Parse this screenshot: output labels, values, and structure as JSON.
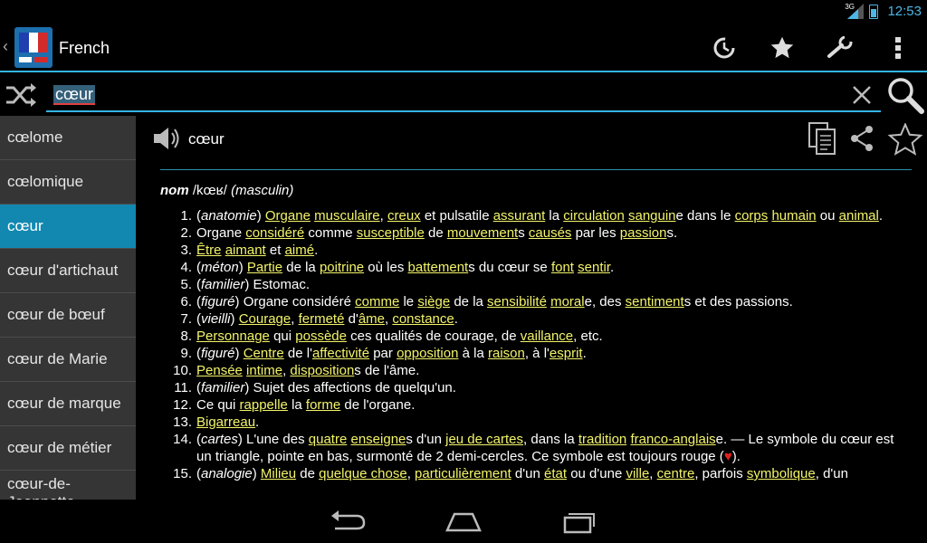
{
  "status": {
    "network": "3G",
    "time": "12:53"
  },
  "app": {
    "title": "French"
  },
  "search": {
    "query": "cœur"
  },
  "word_list": [
    {
      "label": "cœlome",
      "selected": false
    },
    {
      "label": "cœlomique",
      "selected": false
    },
    {
      "label": "cœur",
      "selected": true
    },
    {
      "label": "cœur d'artichaut",
      "selected": false
    },
    {
      "label": "cœur de bœuf",
      "selected": false
    },
    {
      "label": "cœur de Marie",
      "selected": false
    },
    {
      "label": "cœur de marque",
      "selected": false
    },
    {
      "label": "cœur de métier",
      "selected": false
    },
    {
      "label": "cœur-de-Jeannette",
      "selected": false
    }
  ],
  "entry": {
    "headword": "cœur",
    "pos_label": "nom",
    "pronunciation": "/kœʁ/",
    "gender": "(masculin)",
    "definitions": [
      {
        "num": "1.",
        "parts": [
          [
            "(",
            0
          ],
          [
            "anatomie",
            2
          ],
          [
            ") ",
            0
          ],
          [
            "Organe",
            1
          ],
          [
            " ",
            0
          ],
          [
            "musculaire",
            1
          ],
          [
            ", ",
            0
          ],
          [
            "creux",
            1
          ],
          [
            " et pulsatile ",
            0
          ],
          [
            "assurant",
            1
          ],
          [
            " la ",
            0
          ],
          [
            "circulation",
            1
          ],
          [
            " ",
            0
          ],
          [
            "sanguin",
            1
          ],
          [
            "e dans le ",
            0
          ],
          [
            "corps",
            1
          ],
          [
            " ",
            0
          ],
          [
            "humain",
            1
          ],
          [
            " ou ",
            0
          ],
          [
            "animal",
            1
          ],
          [
            ".",
            0
          ]
        ]
      },
      {
        "num": "2.",
        "parts": [
          [
            "Organe ",
            0
          ],
          [
            "considéré",
            1
          ],
          [
            " comme ",
            0
          ],
          [
            "susceptible",
            1
          ],
          [
            " de ",
            0
          ],
          [
            "mouvement",
            1
          ],
          [
            "s ",
            0
          ],
          [
            "causés",
            1
          ],
          [
            " par les ",
            0
          ],
          [
            "passion",
            1
          ],
          [
            "s.",
            0
          ]
        ]
      },
      {
        "num": "3.",
        "parts": [
          [
            "Être",
            1
          ],
          [
            " ",
            0
          ],
          [
            "aimant",
            1
          ],
          [
            " et ",
            0
          ],
          [
            "aimé",
            1
          ],
          [
            ".",
            0
          ]
        ]
      },
      {
        "num": "4.",
        "parts": [
          [
            "(",
            0
          ],
          [
            "méton",
            2
          ],
          [
            ") ",
            0
          ],
          [
            "Partie",
            1
          ],
          [
            " de la ",
            0
          ],
          [
            "poitrine",
            1
          ],
          [
            " où les ",
            0
          ],
          [
            "battement",
            1
          ],
          [
            "s du cœur se ",
            0
          ],
          [
            "font",
            1
          ],
          [
            " ",
            0
          ],
          [
            "sentir",
            1
          ],
          [
            ".",
            0
          ]
        ]
      },
      {
        "num": "5.",
        "parts": [
          [
            "(",
            0
          ],
          [
            "familier",
            2
          ],
          [
            ") Estomac.",
            0
          ]
        ]
      },
      {
        "num": "6.",
        "parts": [
          [
            "(",
            0
          ],
          [
            "figuré",
            2
          ],
          [
            ") Organe considéré ",
            0
          ],
          [
            "comme",
            1
          ],
          [
            " le ",
            0
          ],
          [
            "siège",
            1
          ],
          [
            " de la ",
            0
          ],
          [
            "sensibilité",
            1
          ],
          [
            " ",
            0
          ],
          [
            "moral",
            1
          ],
          [
            "e, des ",
            0
          ],
          [
            "sentiment",
            1
          ],
          [
            "s et des passions.",
            0
          ]
        ]
      },
      {
        "num": "7.",
        "parts": [
          [
            "(",
            0
          ],
          [
            "vieilli",
            2
          ],
          [
            ") ",
            0
          ],
          [
            "Courage",
            1
          ],
          [
            ", ",
            0
          ],
          [
            "fermeté",
            1
          ],
          [
            " d'",
            0
          ],
          [
            "âme",
            1
          ],
          [
            ", ",
            0
          ],
          [
            "constance",
            1
          ],
          [
            ".",
            0
          ]
        ]
      },
      {
        "num": "8.",
        "parts": [
          [
            "Personnage",
            1
          ],
          [
            " qui ",
            0
          ],
          [
            "possède",
            1
          ],
          [
            " ces qualités de courage, de ",
            0
          ],
          [
            "vaillance",
            1
          ],
          [
            ", etc.",
            0
          ]
        ]
      },
      {
        "num": "9.",
        "parts": [
          [
            "(",
            0
          ],
          [
            "figuré",
            2
          ],
          [
            ") ",
            0
          ],
          [
            "Centre",
            1
          ],
          [
            " de l'",
            0
          ],
          [
            "affectivité",
            1
          ],
          [
            " par ",
            0
          ],
          [
            "opposition",
            1
          ],
          [
            " à la ",
            0
          ],
          [
            "raison",
            1
          ],
          [
            ", à l'",
            0
          ],
          [
            "esprit",
            1
          ],
          [
            ".",
            0
          ]
        ]
      },
      {
        "num": "10.",
        "parts": [
          [
            "Pensée",
            1
          ],
          [
            " ",
            0
          ],
          [
            "intime",
            1
          ],
          [
            ", ",
            0
          ],
          [
            "disposition",
            1
          ],
          [
            "s de l'âme.",
            0
          ]
        ]
      },
      {
        "num": "11.",
        "parts": [
          [
            "(",
            0
          ],
          [
            "familier",
            2
          ],
          [
            ") Sujet des affections de quelqu'un.",
            0
          ]
        ]
      },
      {
        "num": "12.",
        "parts": [
          [
            "Ce qui ",
            0
          ],
          [
            "rappelle",
            1
          ],
          [
            " la ",
            0
          ],
          [
            "forme",
            1
          ],
          [
            " de l'organe.",
            0
          ]
        ]
      },
      {
        "num": "13.",
        "parts": [
          [
            "Bigarreau",
            1
          ],
          [
            ".",
            0
          ]
        ]
      },
      {
        "num": "14.",
        "parts": [
          [
            "(",
            0
          ],
          [
            "cartes",
            2
          ],
          [
            ") L'une des ",
            0
          ],
          [
            "quatre",
            1
          ],
          [
            " ",
            0
          ],
          [
            "enseigne",
            1
          ],
          [
            "s d'un ",
            0
          ],
          [
            "jeu de cartes",
            1
          ],
          [
            ", dans la ",
            0
          ],
          [
            "tradition",
            1
          ],
          [
            " ",
            0
          ],
          [
            "franco-anglais",
            1
          ],
          [
            "e. — Le symbole du cœur est un triangle, pointe en bas, surmonté de 2 demi-cercles. Ce symbole est toujours rouge (",
            0
          ],
          [
            "♥",
            3
          ],
          [
            ").",
            0
          ]
        ]
      },
      {
        "num": "15.",
        "parts": [
          [
            "(",
            0
          ],
          [
            "analogie",
            2
          ],
          [
            ") ",
            0
          ],
          [
            "Milieu",
            1
          ],
          [
            " de ",
            0
          ],
          [
            "quelque chose",
            1
          ],
          [
            ", ",
            0
          ],
          [
            "particulièrement",
            1
          ],
          [
            " d'un ",
            0
          ],
          [
            "état",
            1
          ],
          [
            " ou d'une ",
            0
          ],
          [
            "ville",
            1
          ],
          [
            ", ",
            0
          ],
          [
            "centre",
            1
          ],
          [
            ", parfois ",
            0
          ],
          [
            "symbolique",
            1
          ],
          [
            ", d'un",
            0
          ]
        ]
      }
    ]
  },
  "icons": {
    "statusbar": [
      "signal-icon",
      "battery-icon"
    ],
    "actionbar": [
      "up-arrow-icon",
      "app-flag-icon",
      "history-icon",
      "star-icon",
      "wrench-icon",
      "overflow-menu-icon"
    ],
    "searchbar": [
      "shuffle-icon",
      "clear-icon",
      "search-icon"
    ],
    "entry": [
      "speaker-icon",
      "copy-icon",
      "share-icon",
      "favorite-star-icon"
    ],
    "navbar": [
      "back-icon",
      "home-icon",
      "recents-icon"
    ]
  },
  "colors": {
    "accent": "#33b5e5",
    "selected_item": "#1288b0",
    "link": "#f3f46a",
    "list_bg": "#353535"
  }
}
